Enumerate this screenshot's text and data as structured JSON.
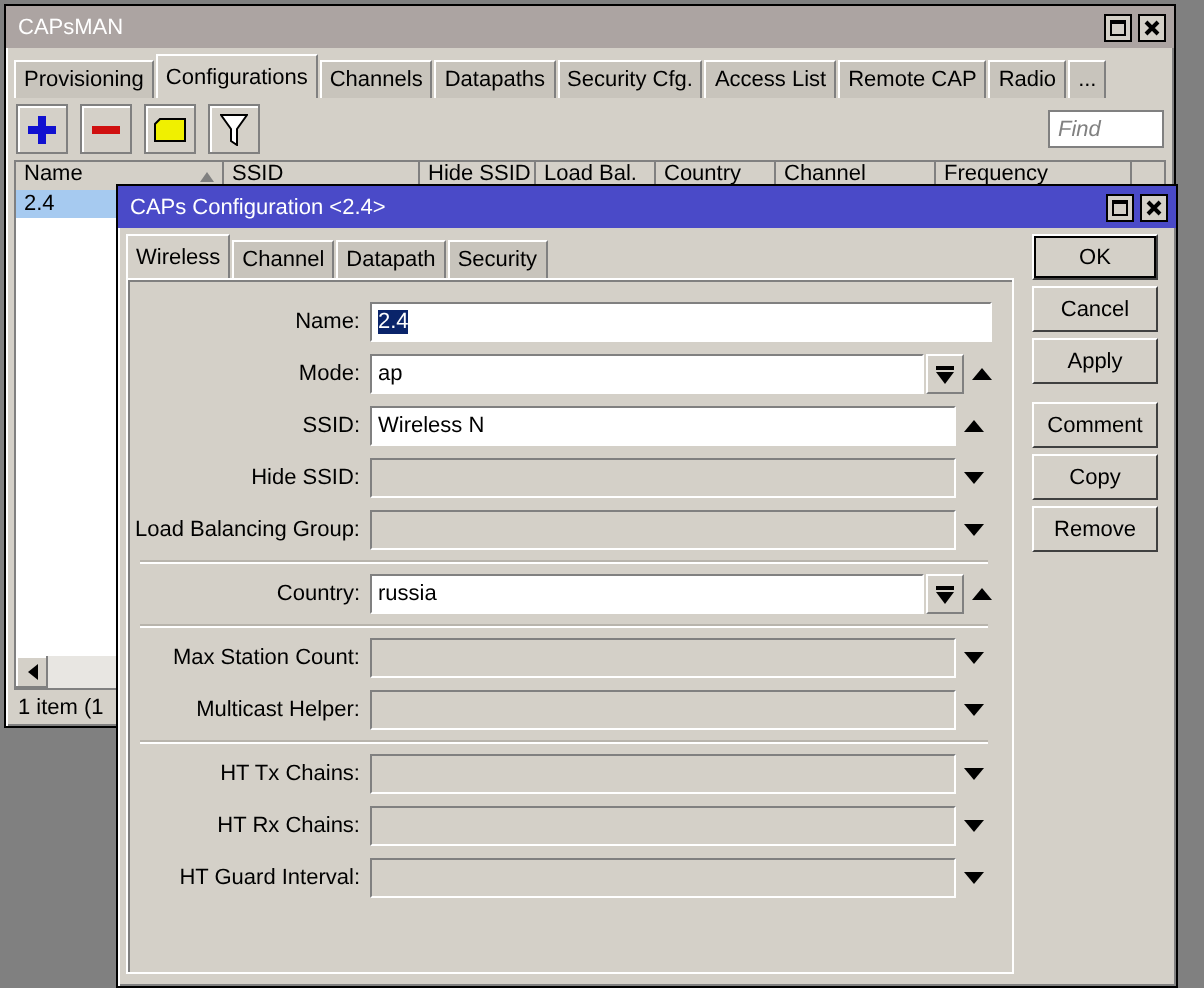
{
  "main_window": {
    "title": "CAPsMAN",
    "tabs": [
      {
        "label": "Provisioning",
        "selected": false
      },
      {
        "label": "Configurations",
        "selected": true
      },
      {
        "label": "Channels",
        "selected": false
      },
      {
        "label": "Datapaths",
        "selected": false
      },
      {
        "label": "Security Cfg.",
        "selected": false
      },
      {
        "label": "Access List",
        "selected": false
      },
      {
        "label": "Remote CAP",
        "selected": false
      },
      {
        "label": "Radio",
        "selected": false
      },
      {
        "label": "...",
        "selected": false
      }
    ],
    "search": {
      "placeholder": "Find"
    },
    "table": {
      "columns": [
        "Name",
        "SSID",
        "Hide SSID",
        "Load Bal.",
        "Country",
        "Channel",
        "Frequency"
      ],
      "rows": [
        {
          "cells": [
            "2.4"
          ],
          "selected": true
        }
      ]
    },
    "status_bar": "1 item (1"
  },
  "dialog": {
    "title": "CAPs Configuration <2.4>",
    "tabs": [
      {
        "label": "Wireless",
        "selected": true
      },
      {
        "label": "Channel",
        "selected": false
      },
      {
        "label": "Datapath",
        "selected": false
      },
      {
        "label": "Security",
        "selected": false
      }
    ],
    "groups": [
      [
        {
          "label": "Name:",
          "value": "2.4",
          "value_selected": true,
          "enabled": true,
          "dropdown": false,
          "expandable": false
        },
        {
          "label": "Mode:",
          "value": "ap",
          "value_selected": false,
          "enabled": true,
          "dropdown": true,
          "expandable": true,
          "expanded": true
        },
        {
          "label": "SSID:",
          "value": "Wireless N",
          "value_selected": false,
          "enabled": true,
          "dropdown": false,
          "expandable": true,
          "expanded": true
        },
        {
          "label": "Hide SSID:",
          "enabled": false,
          "dropdown": false,
          "expandable": true,
          "expanded": false
        },
        {
          "label": "Load Balancing Group:",
          "enabled": false,
          "dropdown": false,
          "expandable": true,
          "expanded": false
        }
      ],
      [
        {
          "label": "Country:",
          "value": "russia",
          "value_selected": false,
          "enabled": true,
          "dropdown": true,
          "expandable": true,
          "expanded": true
        }
      ],
      [
        {
          "label": "Max Station Count:",
          "enabled": false,
          "dropdown": false,
          "expandable": true,
          "expanded": false
        },
        {
          "label": "Multicast Helper:",
          "enabled": false,
          "dropdown": false,
          "expandable": true,
          "expanded": false
        }
      ],
      [
        {
          "label": "HT Tx Chains:",
          "enabled": false,
          "dropdown": false,
          "expandable": true,
          "expanded": false
        },
        {
          "label": "HT Rx Chains:",
          "enabled": false,
          "dropdown": false,
          "expandable": true,
          "expanded": false
        },
        {
          "label": "HT Guard Interval:",
          "enabled": false,
          "dropdown": false,
          "expandable": true,
          "expanded": false
        }
      ]
    ],
    "button_groups": [
      [
        {
          "label": "OK",
          "default": true
        },
        {
          "label": "Cancel",
          "default": false
        },
        {
          "label": "Apply",
          "default": false
        }
      ],
      [
        {
          "label": "Comment",
          "default": false
        },
        {
          "label": "Copy",
          "default": false
        },
        {
          "label": "Remove",
          "default": false
        }
      ]
    ]
  }
}
